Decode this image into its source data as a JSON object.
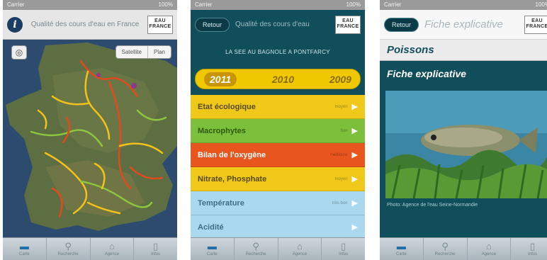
{
  "status": {
    "left": "Carrier",
    "right": "100%"
  },
  "tabs": [
    {
      "name": "tab-map",
      "label": "Carte",
      "icon": "map-icon",
      "glyph": "▬"
    },
    {
      "name": "tab-search",
      "label": "Recherche",
      "icon": "search-icon",
      "glyph": "⚲"
    },
    {
      "name": "tab-institution",
      "label": "Agence",
      "icon": "building-icon",
      "glyph": "⌂"
    },
    {
      "name": "tab-info",
      "label": "Infos",
      "icon": "book-icon",
      "glyph": "▯"
    }
  ],
  "screen1": {
    "title": "Qualité des cours d'eau en France",
    "info_glyph": "i",
    "logo": "EAU FRANCE",
    "locate_glyph": "◎",
    "map_modes": [
      "Satellite",
      "Plan"
    ]
  },
  "screen2": {
    "back": "Retour",
    "title": "Qualité des cours d'eau",
    "logo": "EAU FRANCE",
    "station": "LA SEE AU BAGNOLE A PONTFARCY",
    "years": [
      "2011",
      "2010",
      "2009"
    ],
    "selected_year": "2011",
    "indicators": [
      {
        "label": "Etat écologique",
        "status": "moyen",
        "color": "#efc81a",
        "text": "#5a4a00"
      },
      {
        "label": "Macrophytes",
        "status": "bon",
        "color": "#7cbf3a",
        "text": "#2f5a0c"
      },
      {
        "label": "Bilan de l'oxygène",
        "status": "médiocre",
        "color": "#e8561e",
        "text": "#ffffff"
      },
      {
        "label": "Nitrate, Phosphate",
        "status": "moyen",
        "color": "#efc81a",
        "text": "#5a4a00"
      },
      {
        "label": "Température",
        "status": "très bon",
        "color": "#a9d8ef",
        "text": "#3f6f86"
      },
      {
        "label": "Acidité",
        "status": "",
        "color": "#a9d8ef",
        "text": "#3f6f86"
      }
    ]
  },
  "screen3": {
    "back": "Retour",
    "title": "Fiche explicative",
    "logo": "EAU FRANCE",
    "heading": "Poissons",
    "subheading": "Fiche explicative",
    "caption": "Photo: Agence de l'eau Seine-Normandie"
  }
}
